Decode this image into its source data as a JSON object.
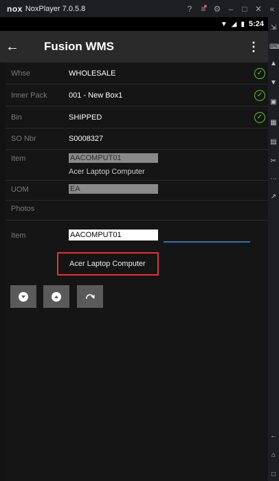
{
  "nox": {
    "logo": "nox",
    "version": "NoxPlayer 7.0.5.8",
    "controls": [
      "?",
      "≡",
      "⚙",
      "–",
      "□",
      "✕",
      "«"
    ]
  },
  "status_bar": {
    "time": "5:24"
  },
  "app_bar": {
    "title": "Fusion WMS"
  },
  "fields": [
    {
      "label": "Whse",
      "value": "WHOLESALE",
      "checked": true
    },
    {
      "label": "Inner Pack",
      "value": "001 - New Box1",
      "checked": true
    },
    {
      "label": "Bin",
      "value": "SHIPPED",
      "checked": true
    },
    {
      "label": "SO Nbr",
      "value": "S0008327"
    },
    {
      "label": "Item",
      "value": "AACOMPUT01",
      "description": "Acer Laptop Computer"
    },
    {
      "label": "UOM",
      "value": "EA"
    },
    {
      "label": "Photos"
    }
  ],
  "item_entry": {
    "label": "Item",
    "value": "AACOMPUT01",
    "description": "Acer Laptop Computer"
  },
  "colors": {
    "check": "#67c23a",
    "highlight": "#d9363e",
    "underline": "#2b73c4"
  }
}
